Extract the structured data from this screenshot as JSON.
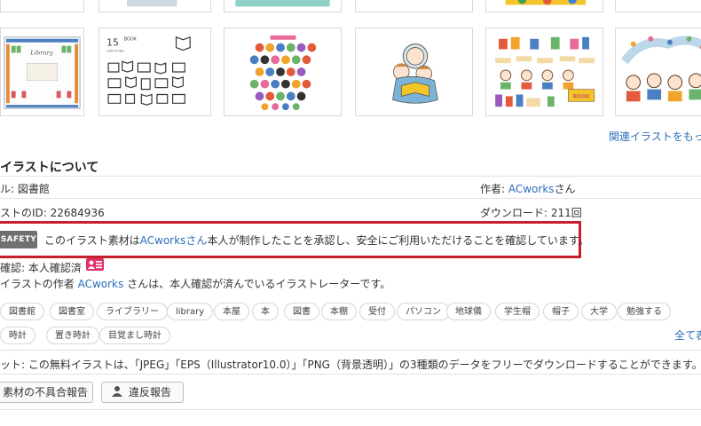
{
  "related": {
    "link_label": "関連イラストをもっ"
  },
  "thumb_texts": {
    "library_title": "Library",
    "book_count": "15",
    "book_word": "BOOK",
    "book_sub": "LINE ICONS",
    "book_sign": "BOOK"
  },
  "about": {
    "heading": "イラストについて",
    "title_row": "ル: 図書館",
    "author_label": "作者: ",
    "author_name": "ACworks",
    "author_suffix": "さん",
    "id_row": "ストのID: 22684936",
    "download_row": "ダウンロード: 211回"
  },
  "safety": {
    "badge": "SAFETY",
    "text_before": "このイラスト素材は",
    "author_link": "ACworksさん",
    "text_after": "本人が制作したことを承認し、安全にご利用いただけることを確認しています。"
  },
  "identity": {
    "status": "確認: 本人確認済",
    "desc_before": "イラストの作者 ",
    "desc_link": "ACworks",
    "desc_after": " さんは、本人確認が済んでいるイラストレーターです。"
  },
  "tags": [
    "図書館",
    "図書室",
    "ライブラリー",
    "library",
    "本屋",
    "本",
    "図書",
    "本棚",
    "受付",
    "パソコン",
    "地球儀",
    "学生帽",
    "帽子",
    "大学",
    "勉強する",
    "時計",
    "置き時計",
    "目覚まし時計"
  ],
  "tags_more": "全て表",
  "note": "ット: この無料イラストは、「JPEG」「EPS（Illustrator10.0）」「PNG（背景透明）」の3種類のデータをフリーでダウンロードすることができます。",
  "buttons": {
    "defect": "素材の不具合報告",
    "violation": "違反報告"
  },
  "colors": {
    "link": "#2a6ebb",
    "safety_border": "#c8202a",
    "badge": "#707070"
  }
}
